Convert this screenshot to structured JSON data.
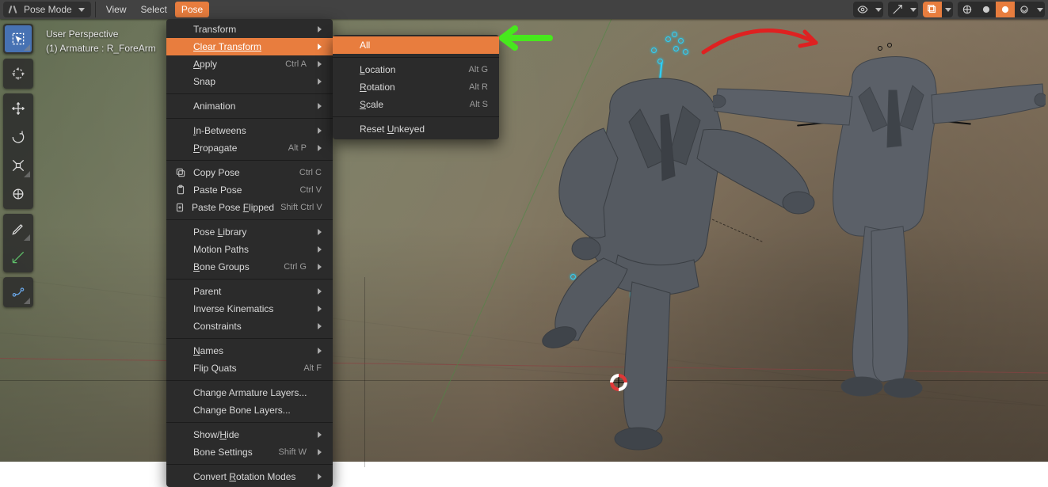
{
  "header": {
    "mode": "Pose Mode",
    "menus": {
      "view": "View",
      "select": "Select",
      "pose": "Pose"
    }
  },
  "info": {
    "line1": "User Perspective",
    "line2": "(1) Armature : R_ForeArm"
  },
  "pose_menu": {
    "transform": "Transform",
    "clear_transform": "Clear Transform",
    "apply": "Apply",
    "apply_sc": "Ctrl A",
    "snap": "Snap",
    "animation": "Animation",
    "in_betweens": "In-Betweens",
    "propagate": "Propagate",
    "propagate_sc": "Alt P",
    "copy_pose": "Copy Pose",
    "copy_pose_sc": "Ctrl C",
    "paste_pose": "Paste Pose",
    "paste_pose_sc": "Ctrl V",
    "paste_flipped": "Paste Pose Flipped",
    "paste_flipped_sc": "Shift Ctrl V",
    "pose_library": "Pose Library",
    "motion_paths": "Motion Paths",
    "bone_groups": "Bone Groups",
    "bone_groups_sc": "Ctrl G",
    "parent": "Parent",
    "ik": "Inverse Kinematics",
    "constraints": "Constraints",
    "names": "Names",
    "flip_quats": "Flip Quats",
    "flip_quats_sc": "Alt F",
    "change_arm_layers": "Change Armature Layers...",
    "change_bone_layers": "Change Bone Layers...",
    "show_hide": "Show/Hide",
    "bone_settings": "Bone Settings",
    "bone_settings_sc": "Shift W",
    "convert_rot": "Convert Rotation Modes"
  },
  "clear_submenu": {
    "all": "All",
    "location": "Location",
    "location_sc": "Alt G",
    "rotation": "Rotation",
    "rotation_sc": "Alt R",
    "scale": "Scale",
    "scale_sc": "Alt S",
    "reset_unkeyed": "Reset Unkeyed"
  }
}
